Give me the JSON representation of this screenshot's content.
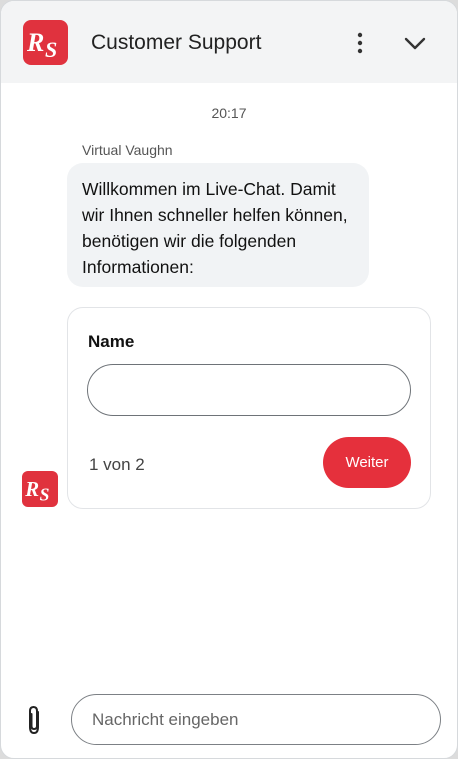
{
  "header": {
    "logo_icon": "rs-brand-logo",
    "title": "Customer Support",
    "menu_icon": "vertical-dots-icon",
    "collapse_icon": "chevron-down-icon"
  },
  "conversation": {
    "timestamp": "20:17",
    "sender": "Virtual Vaughn",
    "message_lines": [
      "Willkommen im Live-Chat. Damit",
      "wir Ihnen schneller helfen können,",
      "benötigen wir die folgenden",
      "Informationen:"
    ]
  },
  "form": {
    "field_label": "Name",
    "field_value": "",
    "step_text": "1 von 2",
    "next_label": "Weiter"
  },
  "composer": {
    "attach_icon": "paperclip-icon",
    "placeholder": "Nachricht eingeben",
    "value": ""
  },
  "colors": {
    "brand_red": "#e5303c",
    "header_bg": "#f3f4f5",
    "bubble_bg": "#f1f3f5"
  }
}
